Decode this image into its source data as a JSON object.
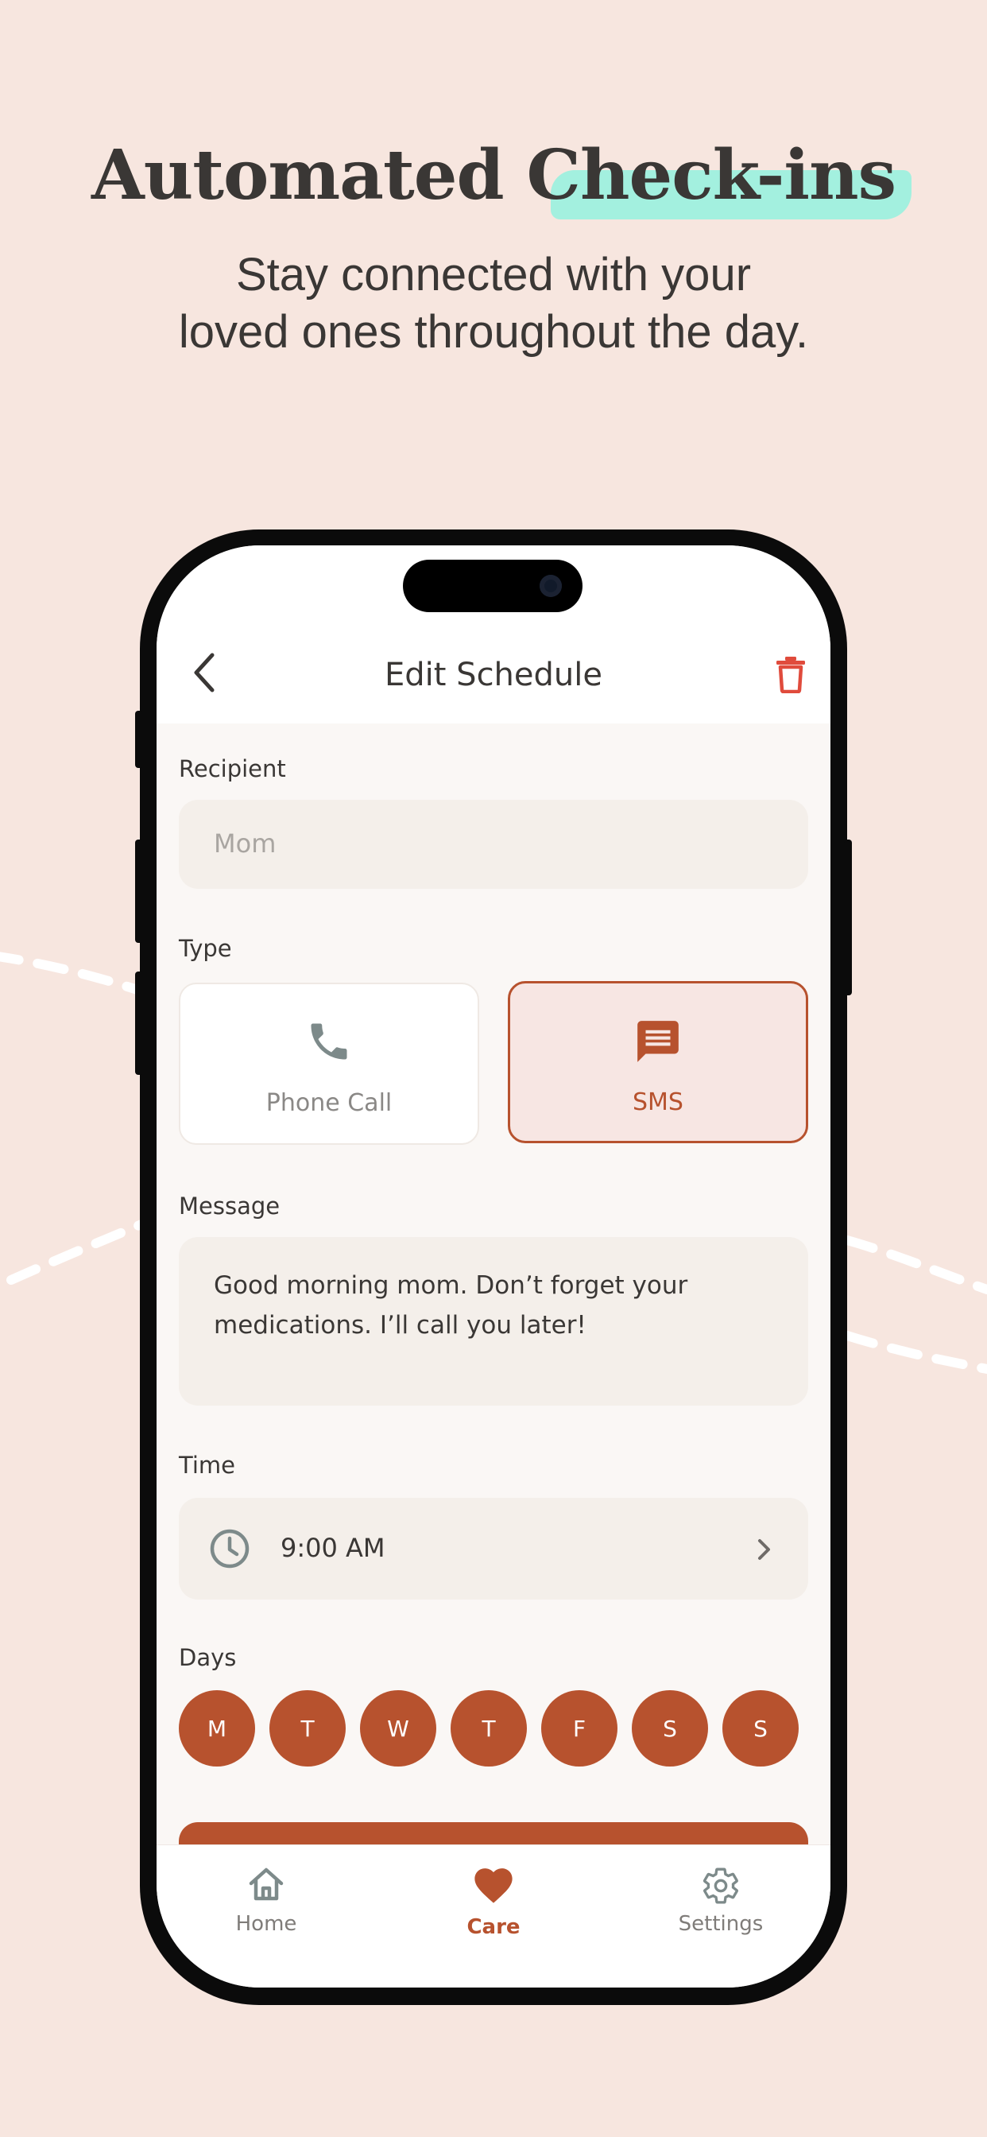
{
  "hero": {
    "title_part1": "Automated ",
    "title_part2": "Check-ins",
    "subtitle_line1": "Stay connected with your",
    "subtitle_line2": "loved ones throughout the day."
  },
  "header": {
    "title": "Edit Schedule"
  },
  "recipient": {
    "label": "Recipient",
    "placeholder": "Mom"
  },
  "type": {
    "label": "Type",
    "options": [
      {
        "label": "Phone Call",
        "selected": false
      },
      {
        "label": "SMS",
        "selected": true
      }
    ]
  },
  "message": {
    "label": "Message",
    "line1": "Good morning mom. Don’t forget your",
    "line2": "medications. I’ll call you later!"
  },
  "time": {
    "label": "Time",
    "value": "9:00 AM"
  },
  "days": {
    "label": "Days",
    "items": [
      "M",
      "T",
      "W",
      "T",
      "F",
      "S",
      "S"
    ]
  },
  "nav": {
    "items": [
      {
        "label": "Home",
        "active": false
      },
      {
        "label": "Care",
        "active": true
      },
      {
        "label": "Settings",
        "active": false
      }
    ]
  },
  "colors": {
    "background": "#f7e6df",
    "accent": "#b7522e",
    "danger": "#e04b3c",
    "highlight": "#9ef0de",
    "muted_icon": "#7d8a8a"
  },
  "icons": {
    "back": "chevron-left-icon",
    "delete": "trash-icon",
    "phone": "phone-icon",
    "sms": "message-icon",
    "time": "clock-icon",
    "time_arrow": "chevron-right-icon",
    "home": "home-icon",
    "care": "heart-icon",
    "settings": "gear-icon"
  }
}
